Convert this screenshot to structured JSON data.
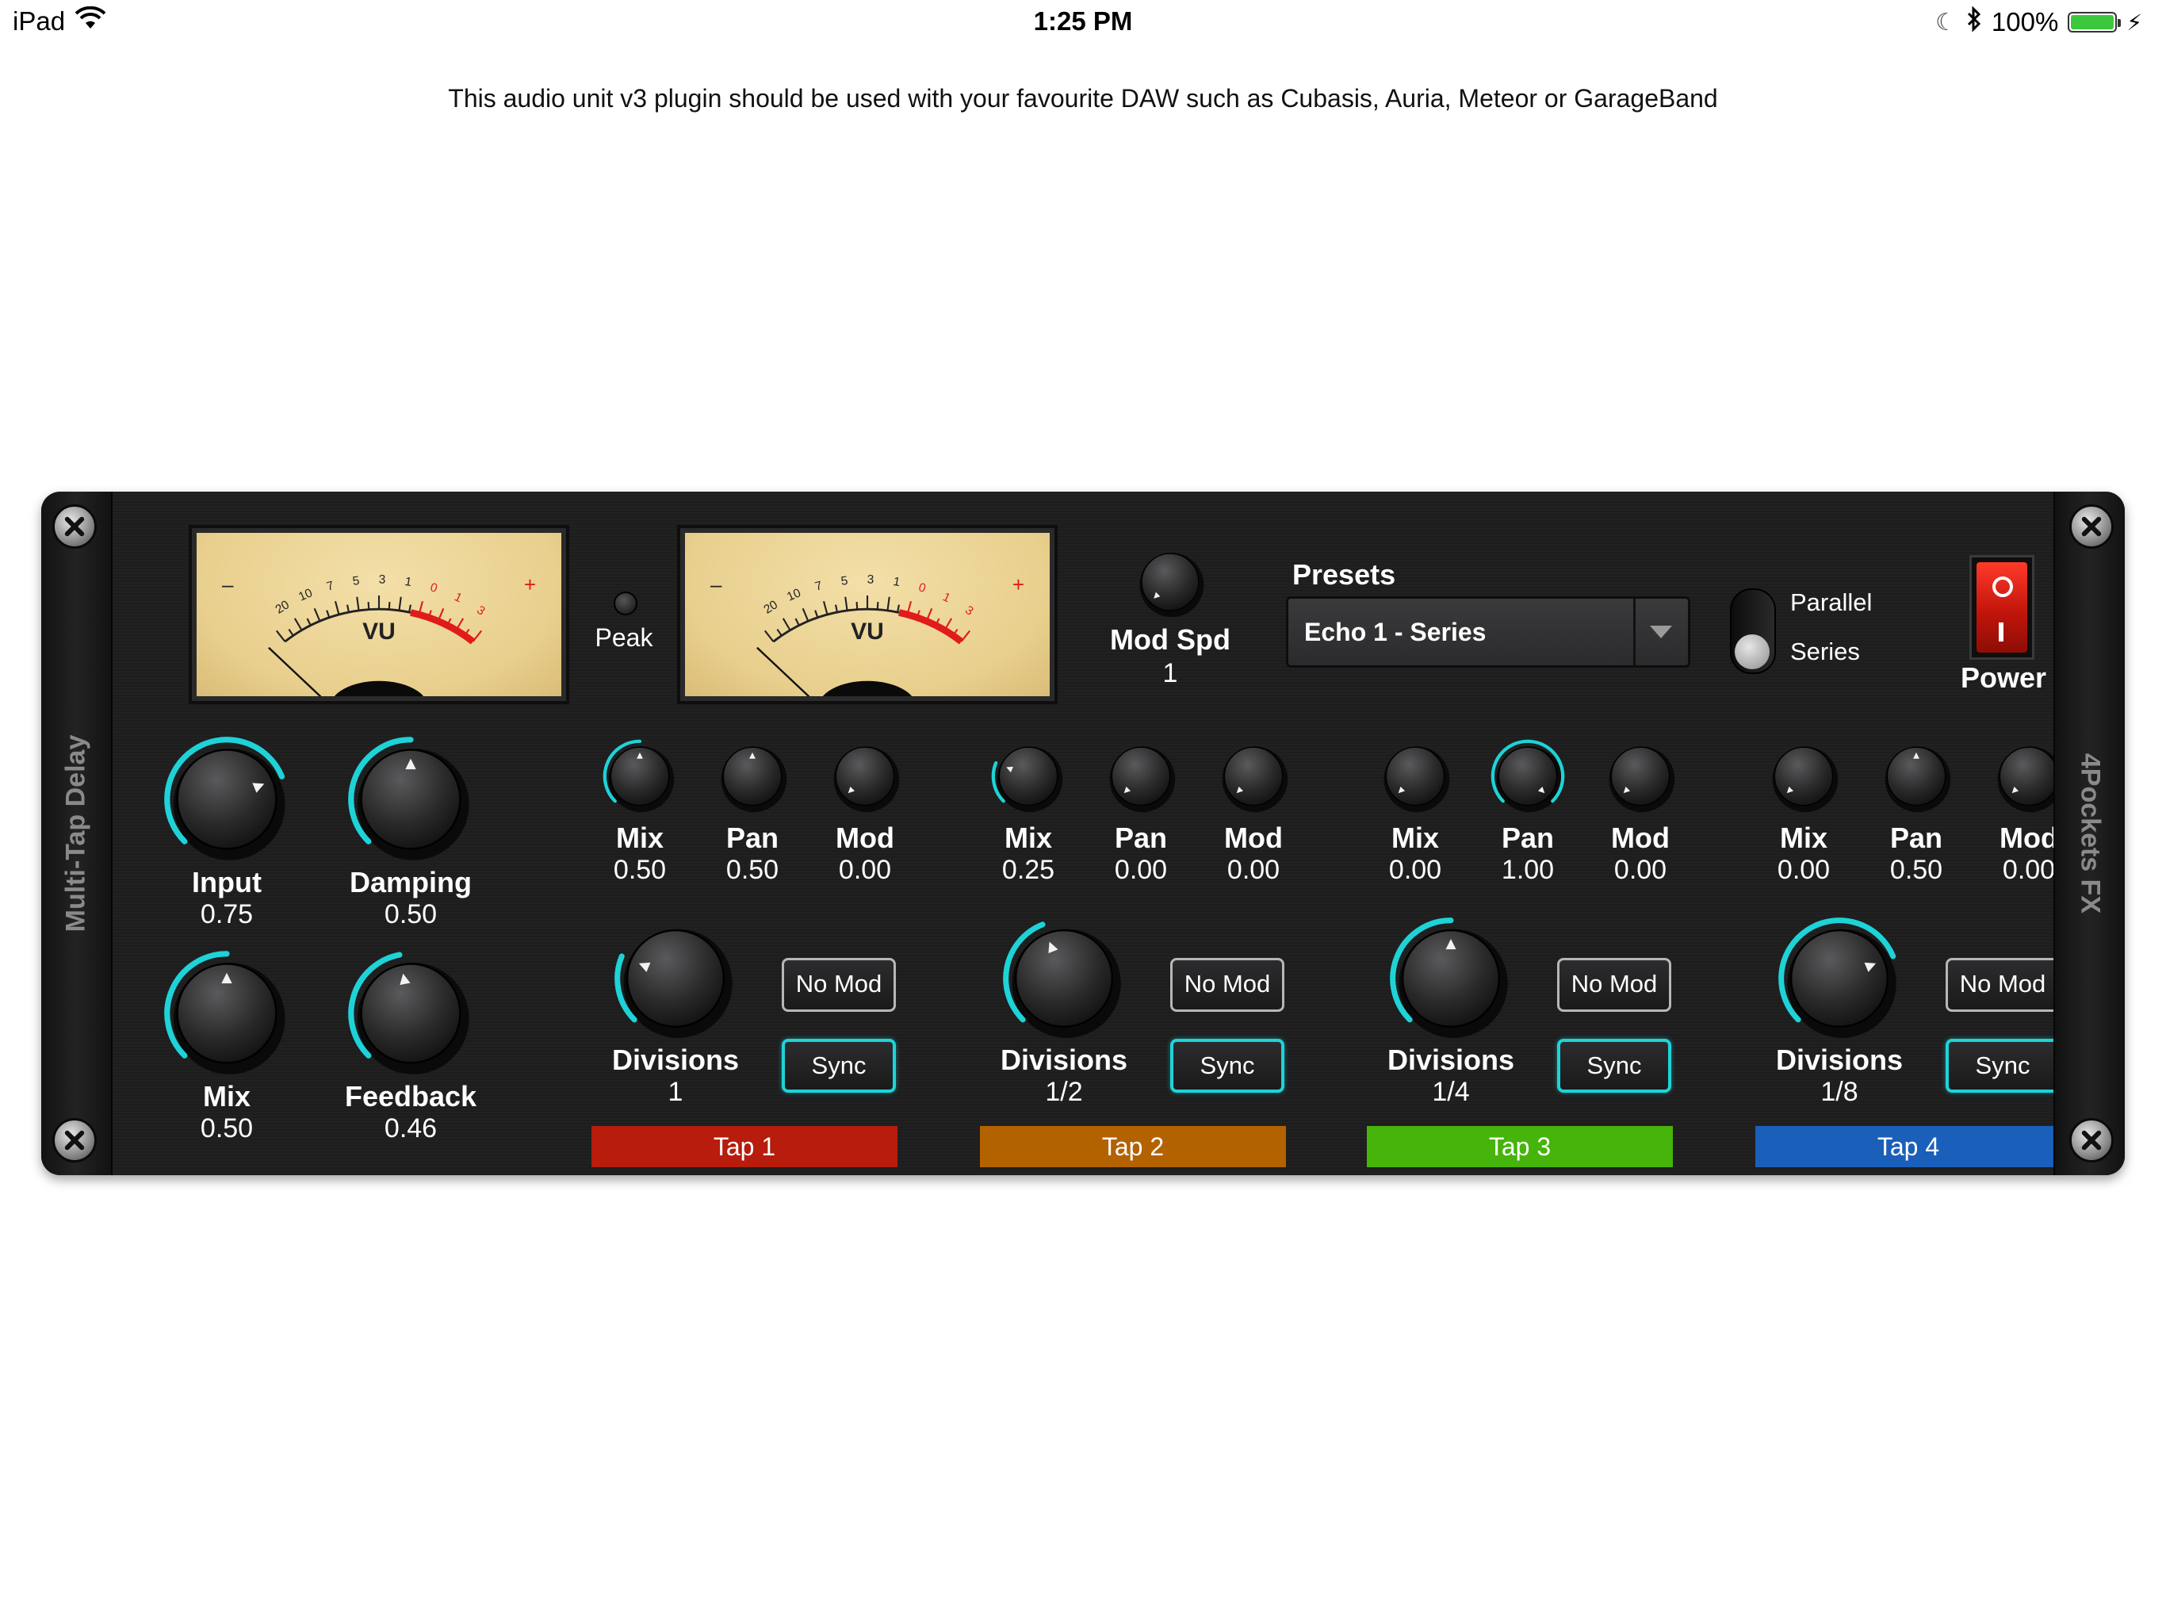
{
  "status_bar": {
    "device": "iPad",
    "time": "1:25 PM",
    "battery": "100%",
    "icons": [
      "wifi-icon",
      "moon-icon",
      "bluetooth-icon",
      "battery-icon",
      "charging-bolt-icon"
    ]
  },
  "info_text": "This audio unit v3 plugin should be used with your favourite DAW such as Cubasis, Auria, Meteor or GarageBand",
  "plugin": {
    "title": "Multi-Tap Delay",
    "brand": "4Pockets FX",
    "vu_label": "VU",
    "vu_scale": [
      "20",
      "10",
      "7",
      "5",
      "3",
      "1",
      "0",
      "1",
      "3"
    ],
    "vu_minus": "–",
    "vu_plus": "+",
    "peak_label": "Peak",
    "mod_spd": {
      "label": "Mod Spd",
      "value": "1"
    },
    "presets": {
      "label": "Presets",
      "selected": "Echo 1 - Series"
    },
    "routing": {
      "option_a": "Parallel",
      "option_b": "Series",
      "selected": "Series"
    },
    "power_label": "Power",
    "accent_color": "#1ed3d8",
    "global_knobs": [
      {
        "label": "Input",
        "value": "0.75",
        "level": 0.75
      },
      {
        "label": "Damping",
        "value": "0.50",
        "level": 0.5
      },
      {
        "label": "Mix",
        "value": "0.50",
        "level": 0.5
      },
      {
        "label": "Feedback",
        "value": "0.46",
        "level": 0.46
      }
    ],
    "taps": [
      {
        "name": "Tap 1",
        "color": "#b71c0c",
        "mix": {
          "label": "Mix",
          "value": "0.50",
          "level": 0.5
        },
        "pan": {
          "label": "Pan",
          "value": "0.50",
          "level": 0.5
        },
        "mod": {
          "label": "Mod",
          "value": "0.00",
          "level": 0.0
        },
        "divisions": {
          "label": "Divisions",
          "value": "1",
          "level": 0.25
        },
        "no_mod": "No Mod",
        "sync": "Sync"
      },
      {
        "name": "Tap 2",
        "color": "#b36200",
        "mix": {
          "label": "Mix",
          "value": "0.25",
          "level": 0.25
        },
        "pan": {
          "label": "Pan",
          "value": "0.00",
          "level": 0.0
        },
        "mod": {
          "label": "Mod",
          "value": "0.00",
          "level": 0.0
        },
        "divisions": {
          "label": "Divisions",
          "value": "1/2",
          "level": 0.42
        },
        "no_mod": "No Mod",
        "sync": "Sync"
      },
      {
        "name": "Tap 3",
        "color": "#46b40a",
        "mix": {
          "label": "Mix",
          "value": "0.00",
          "level": 0.0
        },
        "pan": {
          "label": "Pan",
          "value": "1.00",
          "level": 1.0
        },
        "mod": {
          "label": "Mod",
          "value": "0.00",
          "level": 0.0
        },
        "divisions": {
          "label": "Divisions",
          "value": "1/4",
          "level": 0.5
        },
        "no_mod": "No Mod",
        "sync": "Sync"
      },
      {
        "name": "Tap 4",
        "color": "#1a5fba",
        "mix": {
          "label": "Mix",
          "value": "0.00",
          "level": 0.0
        },
        "pan": {
          "label": "Pan",
          "value": "0.50",
          "level": 0.5
        },
        "mod": {
          "label": "Mod",
          "value": "0.00",
          "level": 0.0
        },
        "divisions": {
          "label": "Divisions",
          "value": "1/8",
          "level": 0.75
        },
        "no_mod": "No Mod",
        "sync": "Sync"
      }
    ]
  }
}
